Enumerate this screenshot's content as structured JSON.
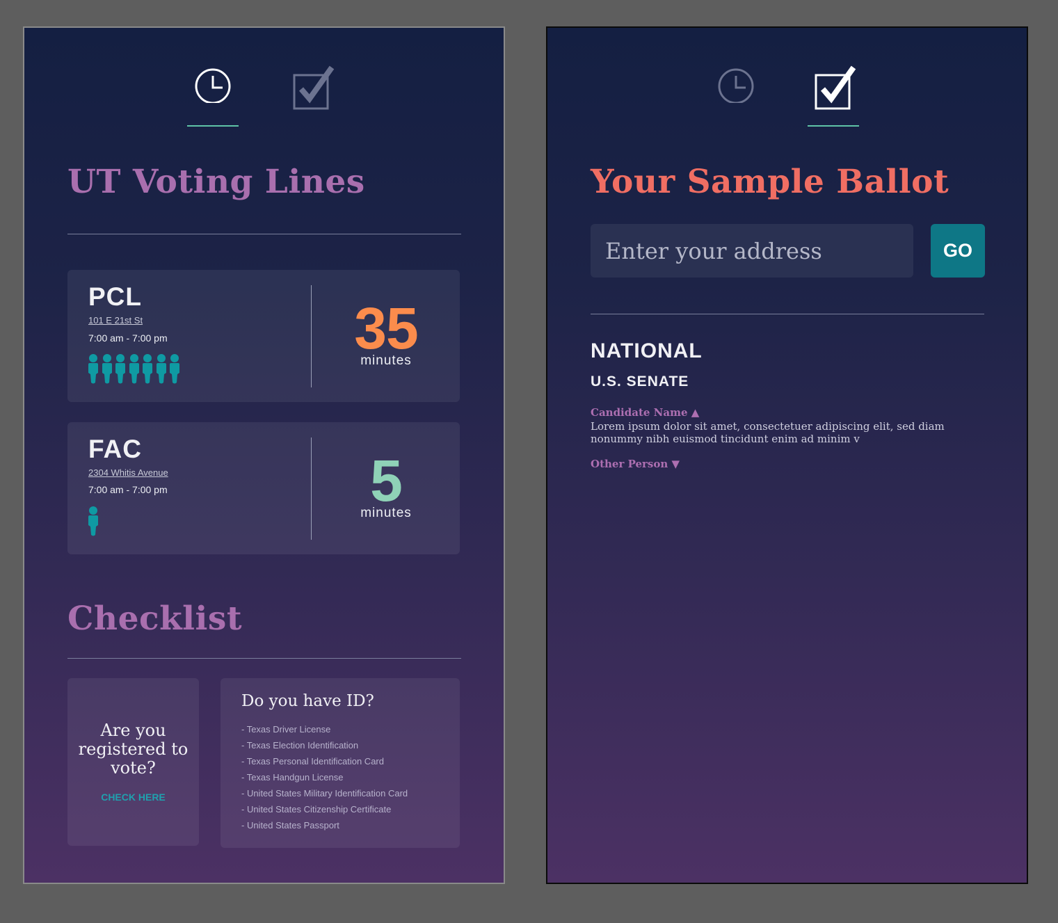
{
  "colors": {
    "accent_purple": "#a96fae",
    "accent_coral": "#f06e63",
    "wait_orange": "#fb8c4c",
    "wait_green": "#8fd2b7",
    "teal": "#0e7786",
    "tab_underline": "#5fc3a7"
  },
  "left_screen": {
    "tabs": [
      {
        "icon": "clock-icon",
        "active": true
      },
      {
        "icon": "checkbox-icon",
        "active": false
      }
    ],
    "title": "UT Voting Lines",
    "locations": [
      {
        "name": "PCL",
        "address": "101 E 21st St",
        "hours": "7:00 am - 7:00 pm",
        "people_count": 7,
        "wait_minutes": "35",
        "wait_unit": "minutes",
        "color": "#fb8c4c"
      },
      {
        "name": "FAC",
        "address": "2304 Whitis Avenue",
        "hours": "7:00 am - 7:00 pm",
        "people_count": 1,
        "wait_minutes": "5",
        "wait_unit": "minutes",
        "color": "#8fd2b7"
      }
    ],
    "checklist": {
      "title": "Checklist",
      "registered": {
        "question": "Are you registered to vote?",
        "link": "CHECK HERE"
      },
      "id": {
        "question": "Do you have ID?",
        "items": [
          "- Texas Driver License",
          "- Texas Election Identification",
          "- Texas Personal Identification Card",
          "- Texas Handgun License",
          "- United States Military Identification Card",
          "- United States Citizenship Certificate",
          "- United States Passport"
        ]
      }
    }
  },
  "right_screen": {
    "tabs": [
      {
        "icon": "clock-icon",
        "active": false
      },
      {
        "icon": "checkbox-icon",
        "active": true
      }
    ],
    "title": "Your Sample Ballot",
    "address_placeholder": "Enter your address",
    "go_label": "GO",
    "section": "NATIONAL",
    "race": "U.S. SENATE",
    "candidates": [
      {
        "name": "Candidate Name",
        "arrow": "▲",
        "expanded": true,
        "description": "Lorem ipsum dolor sit amet, consectetuer adipiscing elit, sed diam nonummy nibh euismod tincidunt enim ad minim v"
      },
      {
        "name": "Other Person",
        "arrow": "▼",
        "expanded": false
      }
    ]
  }
}
